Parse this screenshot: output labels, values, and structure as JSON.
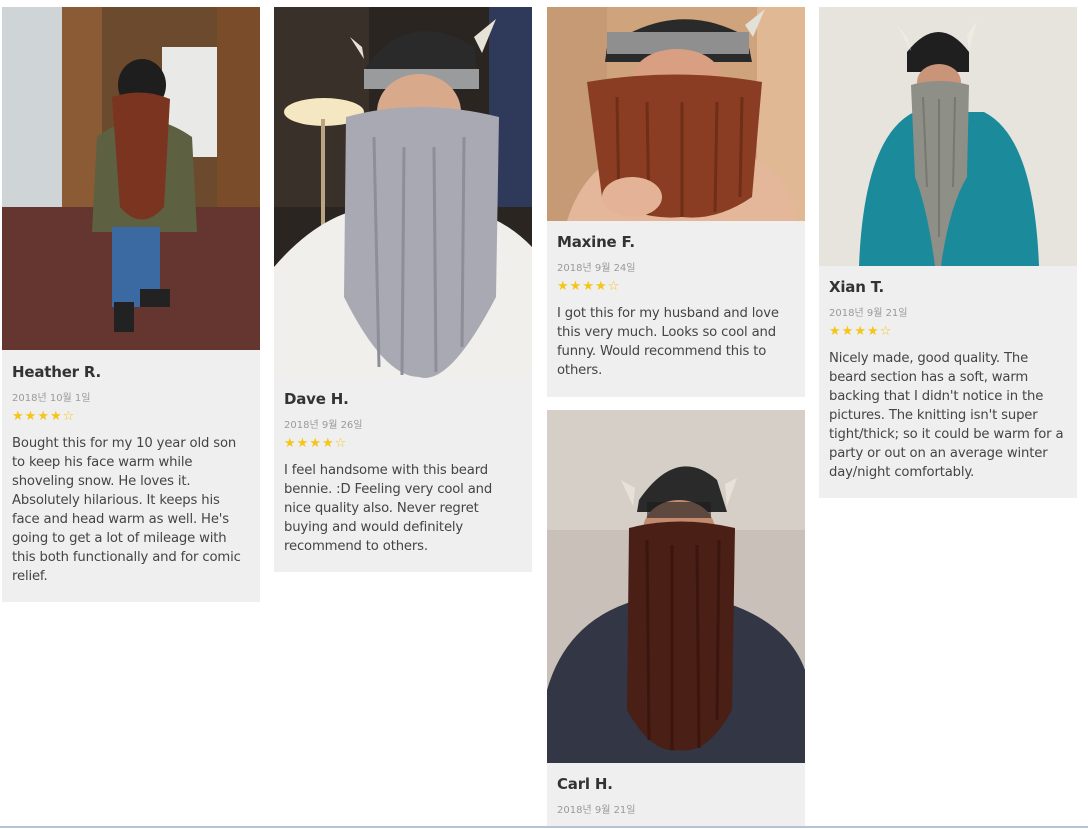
{
  "reviews": [
    {
      "name": "Heather R.",
      "date": "2018년 10월 1일",
      "rating": 4,
      "max_rating": 5,
      "text": "Bought this for my 10 year old son to keep his face warm while shoveling snow. He loves it. Absolutely hilarious. It keeps his face and head warm as well. He's going to get a lot of mileage with this both functionally and for comic relief.",
      "photo_alt": "child wearing red knitted viking beard hat"
    },
    {
      "name": "Dave H.",
      "date": "2018년 9월 26일",
      "rating": 4,
      "max_rating": 5,
      "text": "I feel handsome with this beard bennie. :D Feeling very cool and nice quality also. Never regret buying and would definitely recommend to others.",
      "photo_alt": "man wearing gray braided viking beard hat"
    },
    {
      "name": "Maxine F.",
      "date": "2018년 9월 24일",
      "rating": 4,
      "max_rating": 5,
      "text": "I got this for my husband and love this very much. Looks so cool and funny. Would recommend this to others.",
      "photo_alt": "woman wearing brown viking beard hat"
    },
    {
      "name": "Carl H.",
      "date": "2018년 9월 21일",
      "rating": 4,
      "max_rating": 5,
      "text": "",
      "photo_alt": "man with glasses wearing dark brown viking beard hat"
    },
    {
      "name": "Xian T.",
      "date": "2018년 9월 21일",
      "rating": 4,
      "max_rating": 5,
      "text": "Nicely made, good quality. The beard section has a soft, warm backing that I didn't notice in the pictures. The knitting isn't super tight/thick; so it could be warm for a party or out on an average winter day/night comfortably.",
      "photo_alt": "man in teal sweater wearing gray viking beard hat"
    }
  ],
  "colors": {
    "card_bg": "#efefef",
    "star": "#f5c518",
    "name": "#333333",
    "date": "#9a9a9a"
  }
}
